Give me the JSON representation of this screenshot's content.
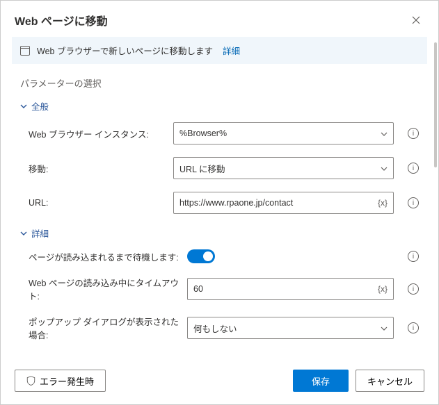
{
  "header": {
    "title": "Web ページに移動"
  },
  "info": {
    "text": "Web ブラウザーで新しいページに移動します",
    "link": "詳細"
  },
  "sectionTitle": "パラメーターの選択",
  "groups": {
    "general": "全般",
    "advanced": "詳細"
  },
  "fields": {
    "browserInstance": {
      "label": "Web ブラウザー インスタンス:",
      "value": "%Browser%"
    },
    "navigate": {
      "label": "移動:",
      "value": "URL に移動"
    },
    "url": {
      "label": "URL:",
      "value": "https://www.rpaone.jp/contact"
    },
    "waitLoad": {
      "label": "ページが読み込まれるまで待機します:",
      "on": true
    },
    "timeout": {
      "label": "Web ページの読み込み中にタイムアウト:",
      "value": "60"
    },
    "popup": {
      "label": "ポップアップ ダイアログが表示された場合:",
      "value": "何もしない"
    }
  },
  "footer": {
    "onError": "エラー発生時",
    "save": "保存",
    "cancel": "キャンセル"
  },
  "brace": "{x}"
}
